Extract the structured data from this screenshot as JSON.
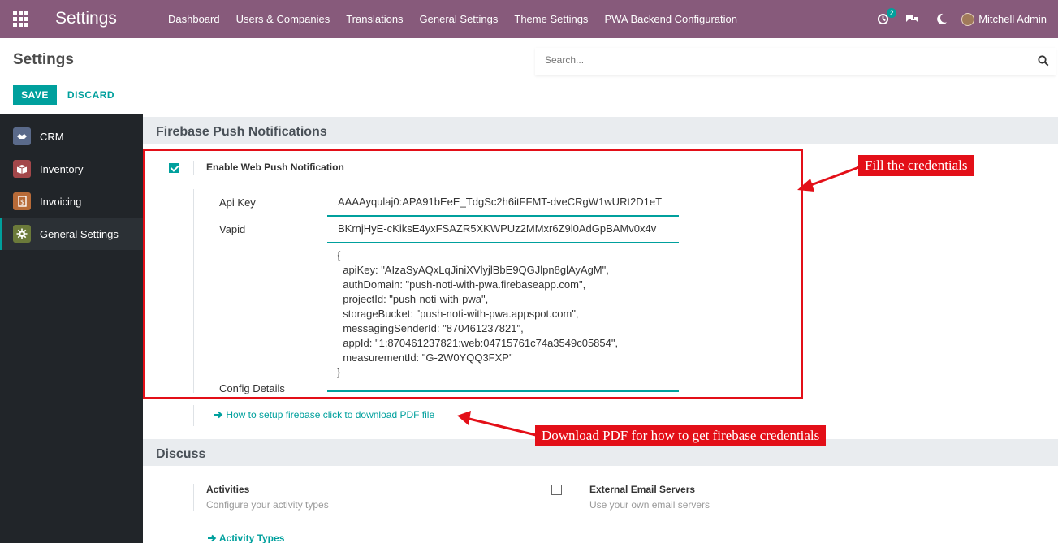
{
  "navbar": {
    "app_title": "Settings",
    "menu": [
      "Dashboard",
      "Users & Companies",
      "Translations",
      "General Settings",
      "Theme Settings",
      "PWA Backend Configuration"
    ],
    "activity_badge": "2",
    "user_name": "Mitchell Admin"
  },
  "control_panel": {
    "title": "Settings",
    "save_label": "SAVE",
    "discard_label": "DISCARD",
    "search_placeholder": "Search..."
  },
  "sidebar": {
    "items": [
      {
        "label": "CRM",
        "icon": "handshake-icon",
        "color": "#5a6a8a"
      },
      {
        "label": "Inventory",
        "icon": "box-icon",
        "color": "#a3474a"
      },
      {
        "label": "Invoicing",
        "icon": "invoice-icon",
        "color": "#b86b38"
      },
      {
        "label": "General Settings",
        "icon": "gear-icon",
        "color": "#6b7a3a",
        "active": true
      }
    ]
  },
  "firebase": {
    "header": "Firebase Push Notifications",
    "enable_label": "Enable Web Push Notification",
    "enabled": true,
    "api_key_label": "Api Key",
    "api_key_value": "AAAAyqulaj0:APA91bEeE_TdgSc2h6itFFMT-dveCRgW1wURt2D1eT",
    "vapid_label": "Vapid",
    "vapid_value": "BKrnjHyE-cKiksE4yxFSAZR5XKWPUz2MMxr6Z9l0AdGpBAMv0x4v",
    "config_label": "Config Details",
    "config_value": "{\n  apiKey: \"AIzaSyAQxLqJiniXVlyjlBbE9QGJlpn8glAyAgM\",\n  authDomain: \"push-noti-with-pwa.firebaseapp.com\",\n  projectId: \"push-noti-with-pwa\",\n  storageBucket: \"push-noti-with-pwa.appspot.com\",\n  messagingSenderId: \"870461237821\",\n  appId: \"1:870461237821:web:04715761c74a3549c05854\",\n  measurementId: \"G-2W0YQQ3FXP\"\n}",
    "pdf_link": "How to setup firebase click to download PDF file"
  },
  "discuss": {
    "header": "Discuss",
    "activities_title": "Activities",
    "activities_desc": "Configure your activity types",
    "activity_types_link": "Activity Types",
    "email_title": "External Email Servers",
    "email_desc": "Use your own email servers",
    "email_enabled": false
  },
  "annotations": {
    "fill_credentials": "Fill the credentials",
    "download_pdf": "Download PDF for how to get firebase credentials",
    "color": "#e30f18"
  },
  "colors": {
    "navbar": "#875a7b",
    "accent": "#00a09d",
    "sidebar": "#212529"
  }
}
